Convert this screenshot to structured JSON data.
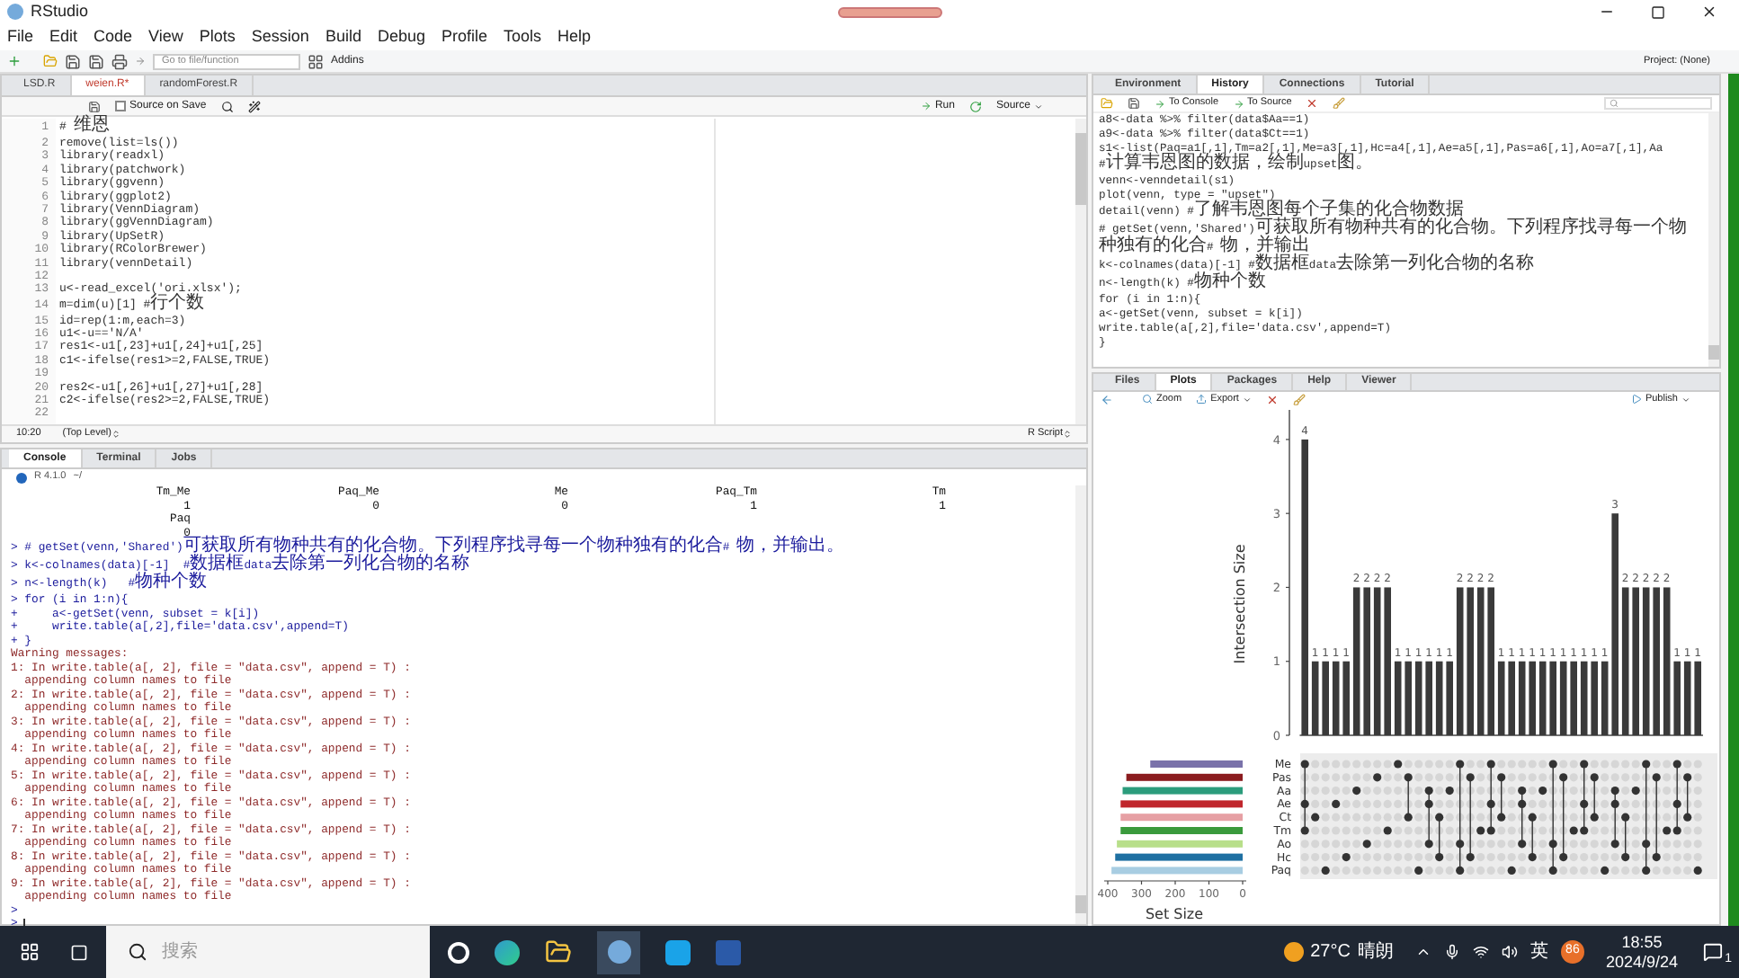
{
  "window": {
    "title": "RStudio"
  },
  "menu": [
    "File",
    "Edit",
    "Code",
    "View",
    "Plots",
    "Session",
    "Build",
    "Debug",
    "Profile",
    "Tools",
    "Help"
  ],
  "toolbar": {
    "goto_placeholder": "Go to file/function",
    "addins": "Addins",
    "project": "Project: (None)"
  },
  "editor": {
    "tabs": [
      {
        "label": "LSD.R",
        "selected": false,
        "modified": false
      },
      {
        "label": "weien.R*",
        "selected": true,
        "modified": true
      },
      {
        "label": "randomForest.R",
        "selected": false,
        "modified": false
      }
    ],
    "source_on_save": {
      "label": "Source on Save",
      "checked": false
    },
    "run": "Run",
    "source": "Source",
    "lines": [
      {
        "n": "1",
        "code": "# 维恩"
      },
      {
        "n": "2",
        "code": "remove(list=ls())"
      },
      {
        "n": "3",
        "code": "library(readxl)"
      },
      {
        "n": "4",
        "code": "library(patchwork)"
      },
      {
        "n": "5",
        "code": "library(ggvenn)"
      },
      {
        "n": "6",
        "code": "library(ggplot2)"
      },
      {
        "n": "7",
        "code": "library(VennDiagram)"
      },
      {
        "n": "8",
        "code": "library(ggVennDiagram)"
      },
      {
        "n": "9",
        "code": "library(UpSetR)"
      },
      {
        "n": "10",
        "code": "library(RColorBrewer)"
      },
      {
        "n": "11",
        "code": "library(vennDetail)"
      },
      {
        "n": "12"
      },
      {
        "n": "13",
        "code": "u<-read_excel('ori.xlsx');"
      },
      {
        "n": "14",
        "code": "m=dim(u)[1] #行个数"
      },
      {
        "n": "15",
        "code": "id=rep(1:m,each=3)"
      },
      {
        "n": "16",
        "code": "u1<-u=='N/A'"
      },
      {
        "n": "17",
        "code": "res1<-u1[,23]+u1[,24]+u1[,25]"
      },
      {
        "n": "18",
        "code": "c1<-ifelse(res1>=2,FALSE,TRUE)"
      },
      {
        "n": "19"
      },
      {
        "n": "20",
        "code": "res2<-u1[,26]+u1[,27]+u1[,28]"
      },
      {
        "n": "21",
        "code": "c2<-ifelse(res2>=2,FALSE,TRUE)"
      },
      {
        "n": "22"
      }
    ],
    "status": {
      "position": "10:20",
      "scope": "(Top Level)",
      "filetype": "R Script"
    }
  },
  "console": {
    "tabs": [
      {
        "label": "Console",
        "selected": true
      },
      {
        "label": "Terminal",
        "selected": false
      },
      {
        "label": "Jobs",
        "selected": false
      }
    ],
    "version": "R 4.1.0",
    "path": "~/",
    "lines": [
      {
        "kind": "columns",
        "cells": [
          "Tm_Me",
          "Paq_Me",
          "Me",
          "Paq_Tm",
          "Tm"
        ]
      },
      {
        "kind": "columns",
        "cells": [
          "1",
          "0",
          "0",
          "1",
          "1"
        ]
      },
      {
        "kind": "columns",
        "cells": [
          "Paq"
        ]
      },
      {
        "kind": "columns",
        "cells": [
          "0"
        ]
      },
      {
        "kind": "input",
        "text": "> # getSet(venn,'Shared')可获取所有物种共有的化合物。下列程序找寻每一个物种独有的化合# 物，并输出。"
      },
      {
        "kind": "input",
        "text": "> k<-colnames(data)[-1]  #数据框data去除第一列化合物的名称"
      },
      {
        "kind": "input",
        "text": "> n<-length(k)   #物种个数"
      },
      {
        "kind": "input",
        "text": "> for (i in 1:n){"
      },
      {
        "kind": "input",
        "text": "+     a<-getSet(venn, subset = k[i])"
      },
      {
        "kind": "input",
        "text": "+     write.table(a[,2],file='data.csv',append=T)"
      },
      {
        "kind": "input",
        "text": "+ }"
      },
      {
        "kind": "warning",
        "text": "Warning messages:"
      },
      {
        "kind": "warning",
        "text": "1: In write.table(a[, 2], file = \"data.csv\", append = T) :"
      },
      {
        "kind": "warning",
        "text": "  appending column names to file"
      },
      {
        "kind": "warning",
        "text": "2: In write.table(a[, 2], file = \"data.csv\", append = T) :"
      },
      {
        "kind": "warning",
        "text": "  appending column names to file"
      },
      {
        "kind": "warning",
        "text": "3: In write.table(a[, 2], file = \"data.csv\", append = T) :"
      },
      {
        "kind": "warning",
        "text": "  appending column names to file"
      },
      {
        "kind": "warning",
        "text": "4: In write.table(a[, 2], file = \"data.csv\", append = T) :"
      },
      {
        "kind": "warning",
        "text": "  appending column names to file"
      },
      {
        "kind": "warning",
        "text": "5: In write.table(a[, 2], file = \"data.csv\", append = T) :"
      },
      {
        "kind": "warning",
        "text": "  appending column names to file"
      },
      {
        "kind": "warning",
        "text": "6: In write.table(a[, 2], file = \"data.csv\", append = T) :"
      },
      {
        "kind": "warning",
        "text": "  appending column names to file"
      },
      {
        "kind": "warning",
        "text": "7: In write.table(a[, 2], file = \"data.csv\", append = T) :"
      },
      {
        "kind": "warning",
        "text": "  appending column names to file"
      },
      {
        "kind": "warning",
        "text": "8: In write.table(a[, 2], file = \"data.csv\", append = T) :"
      },
      {
        "kind": "warning",
        "text": "  appending column names to file"
      },
      {
        "kind": "warning",
        "text": "9: In write.table(a[, 2], file = \"data.csv\", append = T) :"
      },
      {
        "kind": "warning",
        "text": "  appending column names to file"
      },
      {
        "kind": "input",
        "text": ">"
      },
      {
        "kind": "cursor",
        "text": ">"
      }
    ]
  },
  "history_pane": {
    "tabs": [
      {
        "label": "Environment",
        "selected": false
      },
      {
        "label": "History",
        "selected": true
      },
      {
        "label": "Connections",
        "selected": false
      },
      {
        "label": "Tutorial",
        "selected": false
      }
    ],
    "to_console": "To Console",
    "to_source": "To Source",
    "lines": [
      "a8<-data %>% filter(data$Aa==1)",
      "a9<-data %>% filter(data$Ct==1)",
      "s1<-list(Paq=a1[,1],Tm=a2[,1],Me=a3[,1],Hc=a4[,1],Ae=a5[,1],Pas=a6[,1],Ao=a7[,1],Aa",
      "#计算韦恩图的数据，绘制upset图。",
      "venn<-venndetail(s1)",
      "plot(venn, type = \"upset\")",
      "detail(venn) #了解韦恩图每个子集的化合物数据",
      "# getSet(venn,'Shared')可获取所有物种共有的化合物。下列程序找寻每一个物种独有的化合# 物，并输出",
      "k<-colnames(data)[-1] #数据框data去除第一列化合物的名称",
      "n<-length(k) #物种个数",
      "for (i in 1:n){",
      "a<-getSet(venn, subset = k[i])",
      "write.table(a[,2],file='data.csv',append=T)",
      "}"
    ]
  },
  "plots_pane": {
    "tabs": [
      {
        "label": "Files",
        "selected": false
      },
      {
        "label": "Plots",
        "selected": true
      },
      {
        "label": "Packages",
        "selected": false
      },
      {
        "label": "Help",
        "selected": false
      },
      {
        "label": "Viewer",
        "selected": false
      }
    ],
    "zoom": "Zoom",
    "export": "Export",
    "publish": "Publish",
    "intersections": {
      "chart_data": {
        "type": "bar",
        "ylabel": "Intersection Size",
        "categories": [
          null,
          null,
          null,
          null,
          null,
          null,
          null,
          null,
          null,
          null,
          null,
          null,
          null,
          null,
          null,
          null,
          null,
          null,
          null,
          null,
          null,
          null,
          null,
          null,
          null,
          null,
          null,
          null,
          null,
          null,
          null,
          null,
          null,
          null,
          null,
          null,
          null,
          null,
          null
        ],
        "ylim": [
          0,
          4.4
        ],
        "data_labels": true,
        "yticks": [
          {
            "value": 0,
            "label": "0"
          },
          {
            "value": 1,
            "label": "1"
          },
          {
            "value": 2,
            "label": "2"
          },
          {
            "value": 3,
            "label": "3"
          },
          {
            "value": 4,
            "label": "4"
          }
        ],
        "values": [
          4,
          1,
          1,
          1,
          1,
          2,
          2,
          2,
          2,
          1,
          1,
          1,
          1,
          1,
          1,
          2,
          2,
          2,
          2,
          1,
          1,
          1,
          1,
          1,
          1,
          1,
          1,
          1,
          1,
          1,
          3,
          2,
          2,
          2,
          2,
          2,
          1,
          1,
          1
        ],
        "value_labels": [
          "4",
          "1",
          "1",
          "1",
          "1",
          "2",
          "2",
          "2",
          "2",
          "1",
          "1",
          "1",
          "1",
          "1",
          "1",
          "2",
          "2",
          "2",
          "2",
          "1",
          "1",
          "1",
          "1",
          "1",
          "1",
          "1",
          "1",
          "1",
          "1",
          "1",
          "3",
          "2",
          "2",
          "2",
          "2",
          "2",
          "1",
          "1",
          "1"
        ]
      }
    },
    "set_sizes": {
      "chart_data": {
        "type": "bar",
        "orientation": "horizontal",
        "xlabel": "Set Size",
        "categories": [
          "Me",
          "Pas",
          "Aa",
          "Ae",
          "Ct",
          "Tm",
          "Ao",
          "Hc",
          "Paq"
        ],
        "xticks": [
          {
            "value": 400,
            "label": "400"
          },
          {
            "value": 300,
            "label": "300"
          },
          {
            "value": 200,
            "label": "200"
          },
          {
            "value": 100,
            "label": "100"
          },
          {
            "value": 0,
            "label": "0"
          }
        ],
        "xlim": [
          400,
          0
        ],
        "values": [
          274,
          345,
          356,
          362,
          362,
          362,
          373,
          378,
          389
        ],
        "colors": [
          "#7a72aa",
          "#8b1c1f",
          "#2c9c7c",
          "#c0262c",
          "#e6a0a4",
          "#3a9a3c",
          "#b8df8a",
          "#1f70a2",
          "#a8cde2"
        ]
      }
    }
  },
  "taskbar": {
    "search_placeholder": "搜索",
    "temperature": "27°C",
    "weather": "晴朗",
    "ime": "英",
    "badge": "86",
    "time": "18:55",
    "date": "2024/9/24",
    "notifications": "1"
  }
}
